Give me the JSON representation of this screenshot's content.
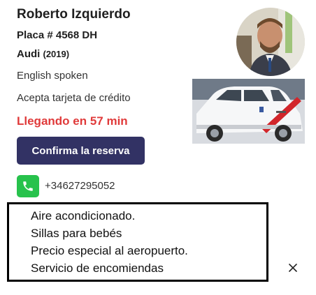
{
  "driver": {
    "name": "Roberto Izquierdo",
    "plate": "Placa # 4568 DH",
    "car_make": "Audi",
    "car_year": "(2019)",
    "language": "English spoken",
    "payment": "Acepta tarjeta de crédito",
    "eta": "Llegando en 57 min",
    "phone": "+34627295052",
    "avatar_icon": "driver-photo",
    "car_image_icon": "taxi-photo"
  },
  "actions": {
    "confirm_label": "Confirma la reserva"
  },
  "extras": [
    "Aire acondicionado.",
    "Sillas para bebés",
    "Precio especial al aeropuerto.",
    "Servicio de encomiendas"
  ],
  "icons": {
    "phone": "phone-icon",
    "close": "close-icon"
  },
  "colors": {
    "eta": "#e03a3a",
    "button_bg": "#323264",
    "phone_badge": "#27c24c"
  }
}
